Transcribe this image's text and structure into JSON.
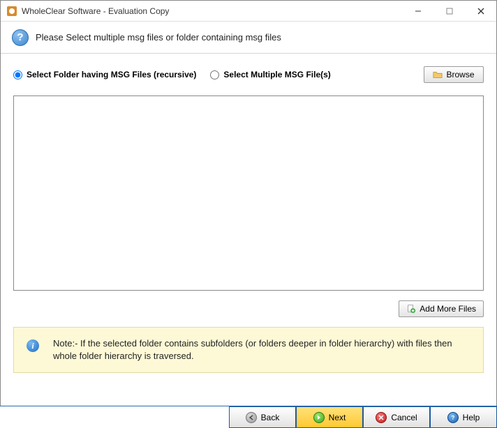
{
  "window": {
    "title": "WholeClear Software - Evaluation Copy"
  },
  "instruction": "Please Select multiple msg files or folder containing msg files",
  "options": {
    "folder_recursive": "Select Folder having MSG Files (recursive)",
    "multiple_files": "Select Multiple MSG File(s)",
    "selected": "folder_recursive"
  },
  "buttons": {
    "browse": "Browse",
    "add_more": "Add More Files"
  },
  "note": "Note:- If the selected folder contains subfolders (or folders deeper in folder hierarchy) with files then whole folder hierarchy is traversed.",
  "footer": {
    "back": "Back",
    "next": "Next",
    "cancel": "Cancel",
    "help": "Help"
  }
}
